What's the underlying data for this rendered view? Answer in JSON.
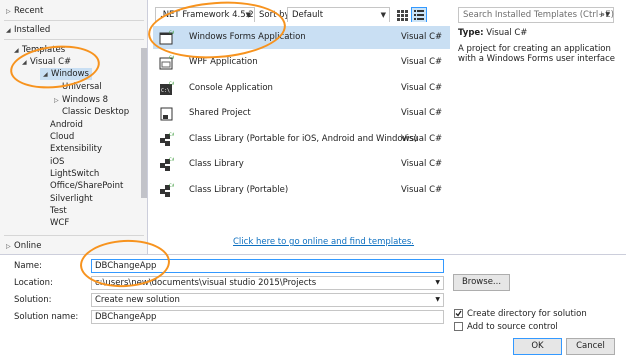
{
  "tree": {
    "recent": "Recent",
    "installed": "Installed",
    "templates": "Templates",
    "visual_csharp": "Visual C#",
    "windows": "Windows",
    "universal": "Universal",
    "windows8": "Windows 8",
    "classic_desktop": "Classic Desktop",
    "android": "Android",
    "cloud": "Cloud",
    "extensibility": "Extensibility",
    "ios": "iOS",
    "lightswitch": "LightSwitch",
    "office_sharepoint": "Office/SharePoint",
    "silverlight": "Silverlight",
    "test": "Test",
    "wcf": "WCF",
    "online": "Online"
  },
  "toolbar": {
    "framework": ".NET Framework 4.5.2",
    "sort_label": "Sort by:",
    "sort_value": "Default",
    "search_placeholder": "Search Installed Templates (Ctrl+E)"
  },
  "templates": [
    {
      "name": "Windows Forms Application",
      "lang": "Visual C#",
      "selected": true
    },
    {
      "name": "WPF Application",
      "lang": "Visual C#"
    },
    {
      "name": "Console Application",
      "lang": "Visual C#"
    },
    {
      "name": "Shared Project",
      "lang": "Visual C#"
    },
    {
      "name": "Class Library (Portable for iOS, Android and Windows)",
      "lang": "Visual C#"
    },
    {
      "name": "Class Library",
      "lang": "Visual C#"
    },
    {
      "name": "Class Library (Portable)",
      "lang": "Visual C#"
    }
  ],
  "online_link": "Click here to go online and find templates.",
  "info": {
    "type_label": "Type:",
    "type_value": "Visual C#",
    "description": "A project for creating an application with a Windows Forms user interface"
  },
  "form": {
    "name_label": "Name:",
    "name_value": "DBChangeApp",
    "location_label": "Location:",
    "location_value": "c:\\users\\new\\documents\\visual studio 2015\\Projects",
    "solution_label": "Solution:",
    "solution_value": "Create new solution",
    "solution_name_label": "Solution name:",
    "solution_name_value": "DBChangeApp",
    "browse_label": "Browse...",
    "create_dir_label": "Create directory for solution",
    "add_source_label": "Add to source control",
    "ok_label": "OK",
    "cancel_label": "Cancel"
  },
  "colors": {
    "accent": "#3399ff",
    "selection": "#c9dff3",
    "annotation": "#f7931e",
    "link": "#0e70c0"
  }
}
